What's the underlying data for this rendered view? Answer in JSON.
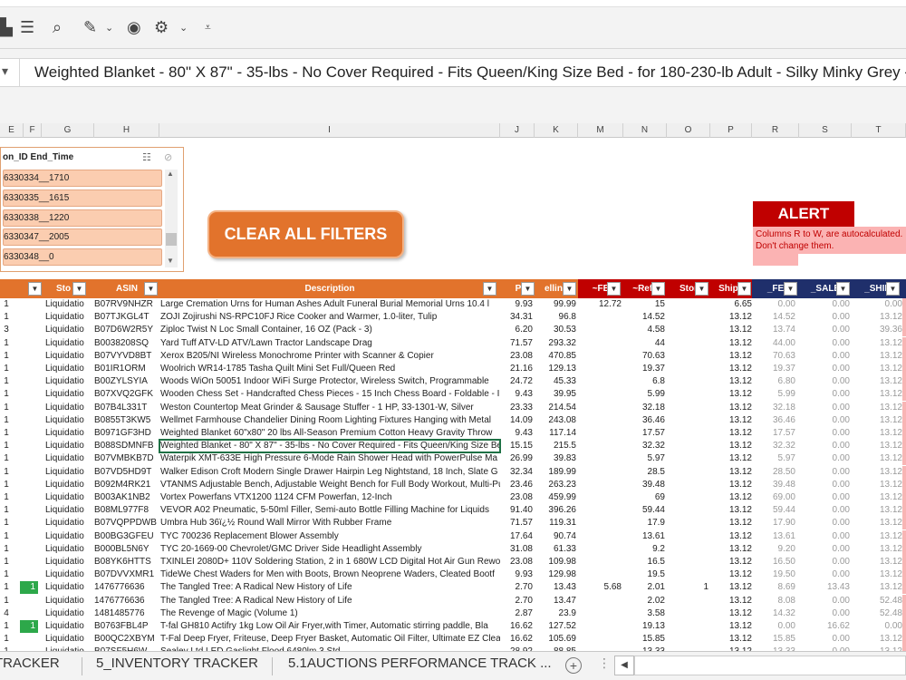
{
  "formula_text": "Weighted Blanket - 80\" X 87\" - 35-lbs - No Cover Required - Fits Queen/King Size Bed - for 180-230-lb Adult - Silky Minky Grey - P",
  "column_letters": [
    "E",
    "F",
    "G",
    "H",
    "I",
    "J",
    "K",
    "M",
    "N",
    "O",
    "P",
    "R",
    "S",
    "T"
  ],
  "slicer": {
    "title": "on_ID End_Time",
    "items": [
      "6330334__1710",
      "6330335__1615",
      "6330338__1220",
      "6330347__2005",
      "6330348__0"
    ]
  },
  "clear_button": "CLEAR ALL FILTERS",
  "alert": {
    "title": "ALERT",
    "message": "Columns R to W, are autocalculated. Don't change them."
  },
  "headers": [
    "S",
    "Sto",
    "ASIN",
    "Description",
    "P",
    "elling",
    "~FE",
    "~Refe",
    "Stor",
    "Shipp",
    "_FE",
    "_SALE",
    "_SHIPI"
  ],
  "rows": [
    [
      "1",
      "",
      "Liquidatio",
      "B07RV9NHZR",
      "Large Cremation Urns for Human Ashes Adult Funeral Burial Memorial Urns 10.4 l",
      "9.93",
      "99.99",
      "12.72",
      "15",
      "",
      "6.65",
      "0.00",
      "0.00",
      "0.00"
    ],
    [
      "1",
      "",
      "Liquidatio",
      "B07TJKGL4T",
      "ZOJI Zojirushi NS-RPC10FJ Rice Cooker and Warmer, 1.0-liter, Tulip",
      "34.31",
      "96.8",
      "",
      "14.52",
      "",
      "13.12",
      "14.52",
      "0.00",
      "13.12"
    ],
    [
      "3",
      "",
      "Liquidatio",
      "B07D6W2R5Y",
      "Ziploc Twist N Loc Small Container, 16 OZ (Pack - 3)",
      "6.20",
      "30.53",
      "",
      "4.58",
      "",
      "13.12",
      "13.74",
      "0.00",
      "39.36"
    ],
    [
      "1",
      "",
      "Liquidatio",
      "B0038208SQ",
      "Yard Tuff ATV-LD ATV/Lawn Tractor Landscape Drag",
      "71.57",
      "293.32",
      "",
      "44",
      "",
      "13.12",
      "44.00",
      "0.00",
      "13.12"
    ],
    [
      "1",
      "",
      "Liquidatio",
      "B07VYVD8BT",
      "Xerox B205/NI Wireless Monochrome Printer with Scanner & Copier",
      "23.08",
      "470.85",
      "",
      "70.63",
      "",
      "13.12",
      "70.63",
      "0.00",
      "13.12"
    ],
    [
      "1",
      "",
      "Liquidatio",
      "B01IR1ORM",
      "Woolrich WR14-1785 Tasha Quilt Mini Set Full/Queen Red",
      "21.16",
      "129.13",
      "",
      "19.37",
      "",
      "13.12",
      "19.37",
      "0.00",
      "13.12"
    ],
    [
      "1",
      "",
      "Liquidatio",
      "B00ZYLSYIA",
      "Woods WiOn 50051 Indoor WiFi Surge Protector, Wireless Switch, Programmable",
      "24.72",
      "45.33",
      "",
      "6.8",
      "",
      "13.12",
      "6.80",
      "0.00",
      "13.12"
    ],
    [
      "1",
      "",
      "Liquidatio",
      "B07XVQ2GFK",
      "Wooden Chess Set - Handcrafted Chess Pieces - 15 Inch Chess Board - Foldable - Ir",
      "9.43",
      "39.95",
      "",
      "5.99",
      "",
      "13.12",
      "5.99",
      "0.00",
      "13.12"
    ],
    [
      "1",
      "",
      "Liquidatio",
      "B07B4L331T",
      "Weston Countertop Meat Grinder & Sausage Stuffer - 1 HP, 33-1301-W, Silver",
      "23.33",
      "214.54",
      "",
      "32.18",
      "",
      "13.12",
      "32.18",
      "0.00",
      "13.12"
    ],
    [
      "1",
      "",
      "Liquidatio",
      "B0855T3KW5",
      "Wellmet Farmhouse Chandelier Dining Room Lighting Fixtures Hanging with Metal",
      "14.09",
      "243.08",
      "",
      "36.46",
      "",
      "13.12",
      "36.46",
      "0.00",
      "13.12"
    ],
    [
      "1",
      "",
      "Liquidatio",
      "B0971GF3HD",
      "Weighted Blanket 60\"x80\" 20 lbs All-Season Premium Cotton Heavy Gravity Throw",
      "9.43",
      "117.14",
      "",
      "17.57",
      "",
      "13.12",
      "17.57",
      "0.00",
      "13.12"
    ],
    [
      "1",
      "",
      "Liquidatio",
      "B088SDMNFB",
      "Weighted Blanket - 80\" X 87\" - 35-lbs - No Cover Required - Fits Queen/King Size Be",
      "15.15",
      "215.5",
      "",
      "32.32",
      "",
      "13.12",
      "32.32",
      "0.00",
      "13.12"
    ],
    [
      "1",
      "",
      "Liquidatio",
      "B07VMBKB7D",
      "Waterpik XMT-633E High Pressure 6-Mode Rain Shower Head with PowerPulse Ma",
      "26.99",
      "39.83",
      "",
      "5.97",
      "",
      "13.12",
      "5.97",
      "0.00",
      "13.12"
    ],
    [
      "1",
      "",
      "Liquidatio",
      "B07VD5HD9T",
      "Walker Edison Croft Modern Single Drawer Hairpin Leg Nightstand, 18 Inch, Slate G",
      "32.34",
      "189.99",
      "",
      "28.5",
      "",
      "13.12",
      "28.50",
      "0.00",
      "13.12"
    ],
    [
      "1",
      "",
      "Liquidatio",
      "B092M4RK21",
      "VTANMS Adjustable Bench, Adjustable Weight Bench for Full Body Workout, Multi-Purpose an",
      "23.46",
      "263.23",
      "",
      "39.48",
      "",
      "13.12",
      "39.48",
      "0.00",
      "13.12"
    ],
    [
      "1",
      "",
      "Liquidatio",
      "B003AK1NB2",
      "Vortex Powerfans VTX1200 1124 CFM Powerfan, 12-Inch",
      "23.08",
      "459.99",
      "",
      "69",
      "",
      "13.12",
      "69.00",
      "0.00",
      "13.12"
    ],
    [
      "1",
      "",
      "Liquidatio",
      "B08ML977F8",
      "VEVOR A02 Pneumatic, 5-50ml Filler, Semi-auto Bottle Filling Machine for Liquids",
      "91.40",
      "396.26",
      "",
      "59.44",
      "",
      "13.12",
      "59.44",
      "0.00",
      "13.12"
    ],
    [
      "1",
      "",
      "Liquidatio",
      "B07VQPPDWB",
      "Umbra Hub 36ï¿½ Round Wall Mirror With Rubber Frame",
      "71.57",
      "119.31",
      "",
      "17.9",
      "",
      "13.12",
      "17.90",
      "0.00",
      "13.12"
    ],
    [
      "1",
      "",
      "Liquidatio",
      "B00BG3GFEU",
      "TYC 700236 Replacement Blower Assembly",
      "17.64",
      "90.74",
      "",
      "13.61",
      "",
      "13.12",
      "13.61",
      "0.00",
      "13.12"
    ],
    [
      "1",
      "",
      "Liquidatio",
      "B000BL5N6Y",
      "TYC 20-1669-00 Chevrolet/GMC Driver Side Headlight Assembly",
      "31.08",
      "61.33",
      "",
      "9.2",
      "",
      "13.12",
      "9.20",
      "0.00",
      "13.12"
    ],
    [
      "1",
      "",
      "Liquidatio",
      "B08YK6HTTS",
      "TXINLEI 2080D+ 110V Soldering Station, 2 in 1 680W LCD Digital Hot Air Gun Rewo",
      "23.08",
      "109.98",
      "",
      "16.5",
      "",
      "13.12",
      "16.50",
      "0.00",
      "13.12"
    ],
    [
      "1",
      "",
      "Liquidatio",
      "B07DVVXMR1",
      "TideWe Chest Waders for Men with Boots, Brown Neoprene Waders, Cleated Bootf",
      "9.93",
      "129.98",
      "",
      "19.5",
      "",
      "13.12",
      "19.50",
      "0.00",
      "13.12"
    ],
    [
      "1",
      "1",
      "Liquidatio",
      "1476776636",
      "The Tangled Tree: A Radical New History of Life",
      "2.70",
      "13.43",
      "5.68",
      "2.01",
      "1",
      "13.12",
      "8.69",
      "13.43",
      "13.12"
    ],
    [
      "1",
      "",
      "Liquidatio",
      "1476776636",
      "The Tangled Tree: A Radical New History of Life",
      "2.70",
      "13.47",
      "",
      "2.02",
      "",
      "13.12",
      "8.08",
      "0.00",
      "52.48"
    ],
    [
      "4",
      "",
      "Liquidatio",
      "1481485776",
      "The Revenge of Magic (Volume 1)",
      "2.87",
      "23.9",
      "",
      "3.58",
      "",
      "13.12",
      "14.32",
      "0.00",
      "52.48"
    ],
    [
      "1",
      "1",
      "Liquidatio",
      "B0763FBL4P",
      "T-fal GH810 Actifry 1kg Low Oil Air Fryer,with Timer, Automatic stirring paddle, Bla",
      "16.62",
      "127.52",
      "",
      "19.13",
      "",
      "13.12",
      "0.00",
      "16.62",
      "0.00"
    ],
    [
      "1",
      "",
      "Liquidatio",
      "B00QC2XBYM",
      "T-Fal Deep Fryer, Friteuse, Deep Fryer Basket, Automatic Oil Filter, Ultimate EZ Clea",
      "16.62",
      "105.69",
      "",
      "15.85",
      "",
      "13.12",
      "15.85",
      "0.00",
      "13.12"
    ],
    [
      "1",
      "",
      "Liquidatio",
      "B07SF5H6W",
      "Sealey Ltd LED Gaslight Flood 6480lm 3 Std",
      "28.92",
      "88.85",
      "",
      "13.33",
      "",
      "13.12",
      "13.33",
      "0.00",
      "13.12"
    ]
  ],
  "tabs": [
    "TRACKER",
    "5_INVENTORY TRACKER",
    "5.1AUCTIONS PERFORMANCE TRACK ..."
  ]
}
